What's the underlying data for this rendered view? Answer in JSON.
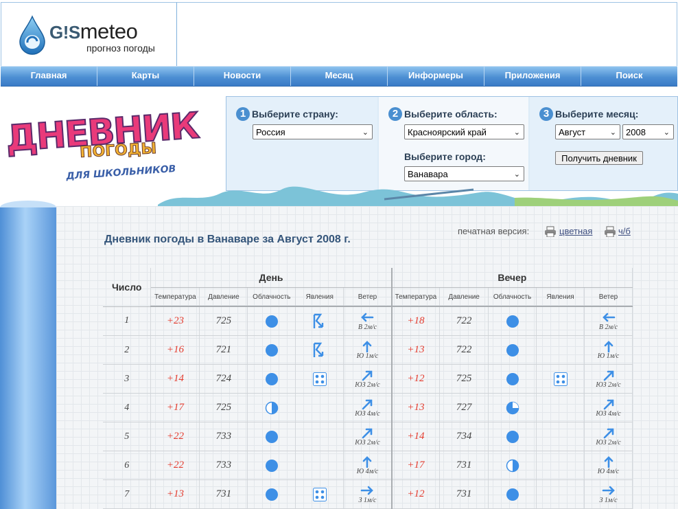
{
  "header": {
    "logo_brand": "meteo",
    "logo_prefix": "G!S",
    "logo_tagline": "прогноз погоды"
  },
  "nav": {
    "items": [
      "Главная",
      "Карты",
      "Новости",
      "Месяц",
      "Информеры",
      "Приложения",
      "Поиск"
    ]
  },
  "banner": {
    "line1": "ДНЕВНИК",
    "line2": "ПОГОДЫ",
    "line3": "ДЛЯ ШКОЛЬНИКОВ"
  },
  "selector": {
    "step1": {
      "num": "1",
      "title": "Выберите страну:",
      "value": "Россия"
    },
    "step2": {
      "num": "2",
      "title": "Выберите область:",
      "value": "Красноярский край",
      "city_title": "Выберите город:",
      "city_value": "Ванавара"
    },
    "step3": {
      "num": "3",
      "title": "Выберите месяц:",
      "month_value": "Август",
      "year_value": "2008",
      "button": "Получить дневник"
    }
  },
  "diary": {
    "title": "Дневник погоды в Ванаваре за Август 2008 г.",
    "print_label": "печатная версия:",
    "print_color": "цветная",
    "print_bw": "ч/б"
  },
  "table": {
    "num_header": "Число",
    "group_day": "День",
    "group_evening": "Вечер",
    "columns": [
      "Температура",
      "Давление",
      "Облачность",
      "Явления",
      "Ветер"
    ],
    "rows": [
      {
        "day": "1",
        "d_temp": "+23",
        "d_press": "725",
        "d_cloud": "full",
        "d_phen": "lightning",
        "d_wind_dir": "W",
        "d_wind": "В 2м/с",
        "e_temp": "+18",
        "e_press": "722",
        "e_cloud": "full",
        "e_phen": "",
        "e_wind_dir": "W",
        "e_wind": "В 2м/с"
      },
      {
        "day": "2",
        "d_temp": "+16",
        "d_press": "721",
        "d_cloud": "full",
        "d_phen": "lightning",
        "d_wind_dir": "N",
        "d_wind": "Ю 1м/с",
        "e_temp": "+13",
        "e_press": "722",
        "e_cloud": "full",
        "e_phen": "",
        "e_wind_dir": "N",
        "e_wind": "Ю 1м/с"
      },
      {
        "day": "3",
        "d_temp": "+14",
        "d_press": "724",
        "d_cloud": "full",
        "d_phen": "rain",
        "d_wind_dir": "NE",
        "d_wind": "ЮЗ 2м/с",
        "e_temp": "+12",
        "e_press": "725",
        "e_cloud": "full",
        "e_phen": "rain",
        "e_wind_dir": "NE",
        "e_wind": "ЮЗ 2м/с"
      },
      {
        "day": "4",
        "d_temp": "+17",
        "d_press": "725",
        "d_cloud": "half",
        "d_phen": "",
        "d_wind_dir": "NE",
        "d_wind": "ЮЗ 4м/с",
        "e_temp": "+13",
        "e_press": "727",
        "e_cloud": "quarter",
        "e_phen": "",
        "e_wind_dir": "NE",
        "e_wind": "ЮЗ 4м/с"
      },
      {
        "day": "5",
        "d_temp": "+22",
        "d_press": "733",
        "d_cloud": "full",
        "d_phen": "",
        "d_wind_dir": "NE",
        "d_wind": "ЮЗ 2м/с",
        "e_temp": "+14",
        "e_press": "734",
        "e_cloud": "full",
        "e_phen": "",
        "e_wind_dir": "NE",
        "e_wind": "ЮЗ 2м/с"
      },
      {
        "day": "6",
        "d_temp": "+22",
        "d_press": "733",
        "d_cloud": "full",
        "d_phen": "",
        "d_wind_dir": "N",
        "d_wind": "Ю 4м/с",
        "e_temp": "+17",
        "e_press": "731",
        "e_cloud": "half",
        "e_phen": "",
        "e_wind_dir": "N",
        "e_wind": "Ю 4м/с"
      },
      {
        "day": "7",
        "d_temp": "+13",
        "d_press": "731",
        "d_cloud": "full",
        "d_phen": "rain",
        "d_wind_dir": "E",
        "d_wind": "З 1м/с",
        "e_temp": "+12",
        "e_press": "731",
        "e_cloud": "full",
        "e_phen": "",
        "e_wind_dir": "E",
        "e_wind": "З 1м/с"
      }
    ]
  },
  "colors": {
    "nav_bg": "#4d8fd3",
    "accent_blue": "#4a8fd0",
    "temp_red": "#e33b2e",
    "icon_blue": "#3d8fe6",
    "title_blue": "#34557a"
  }
}
